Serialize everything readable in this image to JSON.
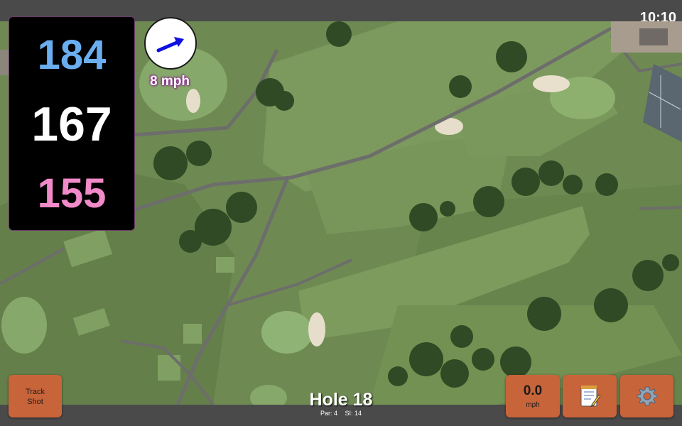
{
  "status_bar": {
    "time": "10:10"
  },
  "distances": {
    "back": {
      "value": "184",
      "color": "#6aaef0"
    },
    "middle": {
      "value": "167",
      "color": "#ffffff"
    },
    "front": {
      "value": "155",
      "color": "#f08ac8"
    }
  },
  "wind": {
    "speed": "8 mph",
    "direction_icon": "arrow-icon",
    "arrow_color": "#1010e0"
  },
  "track_shot": {
    "line1": "Track",
    "line2": "Shot"
  },
  "hole": {
    "title": "Hole 18",
    "par": "Par: 4",
    "si": "SI: 14"
  },
  "speed": {
    "value": "0.0",
    "unit": "mph"
  },
  "icons": {
    "notes": "notepad-icon",
    "settings": "gear-icon"
  },
  "colors": {
    "button": "#c8643a",
    "bar": "#4a4a4a",
    "map_grass": "#6e8a52"
  }
}
